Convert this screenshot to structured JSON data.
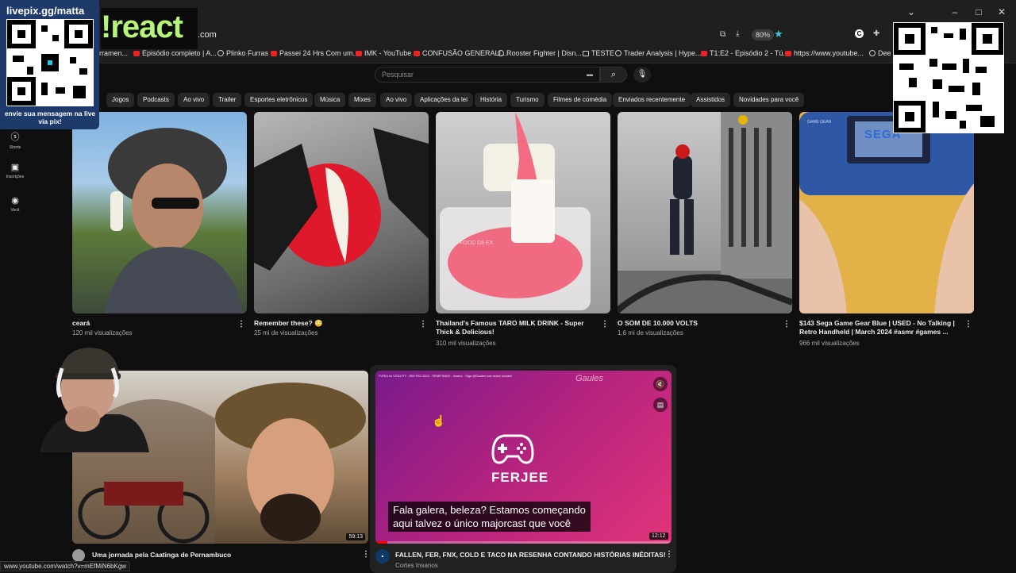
{
  "browser": {
    "url": ".com",
    "zoom": "80%",
    "status_url": "www.youtube.com/watch?v=mEfMiN6bKgw"
  },
  "bookmarks": [
    "rramen...",
    "Episódio completo | A...",
    "Plinko Furras",
    "Passei 24 Hrs Com um...",
    "IMK - YouTube",
    "CONFUSÃO GENERALI...",
    "Rooster Fighter | Disn...",
    "TESTE",
    "Trader Analysis | Hype...",
    "T1:E2 - Episódio 2 - Tú...",
    "https://www.youtube...",
    "Dee"
  ],
  "search": {
    "placeholder": "Pesquisar"
  },
  "chips": [
    "Jogos",
    "Podcasts",
    "Ao vivo",
    "Trailer",
    "Esportes eletrônicos",
    "Música",
    "Mixes",
    "Ao vivo",
    "Aplicações da lei",
    "História",
    "Turismo",
    "Filmes de comédia",
    "Enviados recentemente",
    "Assistidos",
    "Novidades para você"
  ],
  "sidenav": [
    {
      "label": "Shorts",
      "icon": "shorts-icon"
    },
    {
      "label": "Inscrições",
      "icon": "subscriptions-icon"
    },
    {
      "label": "Você",
      "icon": "you-icon"
    }
  ],
  "videos_row1": [
    {
      "title": "ceará",
      "meta": "120 mil visualizações"
    },
    {
      "title": "Remember these? 😳",
      "meta": "25 mi de visualizações"
    },
    {
      "title": "Thailand's Famous TARO MILK DRINK - Super Thick & Delicious!",
      "meta": "310 mil visualizações"
    },
    {
      "title": "O SOM DE 10.000 VOLTS",
      "meta": "1,6 mi de visualizações"
    },
    {
      "title": "$143 Sega Game Gear Blue | USED - No Talking | Retro Handheld | March 2024 #asmr #games ...",
      "meta": "966 mil visualizações"
    }
  ],
  "videos_row2": [
    {
      "title": "Uma jornada pela Caatinga de Pernambuco",
      "duration": "59:13"
    },
    {
      "title": "FALLEN, FER, FNX, COLD E TACO NA RESENHA CONTANDO HISTÓRIAS INÉDITAS!",
      "channel": "Cortes Insanos",
      "duration": "12:12",
      "brand": "FERJEE",
      "watermark": "Gaules",
      "caption_line1": "Fala galera, beleza? Estamos começando",
      "caption_line2": "aqui talvez o único majorcast que você",
      "top_strip": "FURIA vs VITALITY - IEM RIO 2024 - SEMIFINAIS - Insano - Siga @Gaules nas redes sociais!"
    }
  ],
  "thumb_texts": {
    "food_watermark": "FOOD DILEX",
    "sega": "SEGA",
    "sega_small": "GAME GEAR"
  },
  "overlay": {
    "livepix_title": "livepix.gg/matta",
    "livepix_caption": "envie sua mensagem na live via pix!",
    "react_label": "!react"
  },
  "colors": {
    "accent": "#ff0000",
    "brand_pink": "#e0245e"
  }
}
